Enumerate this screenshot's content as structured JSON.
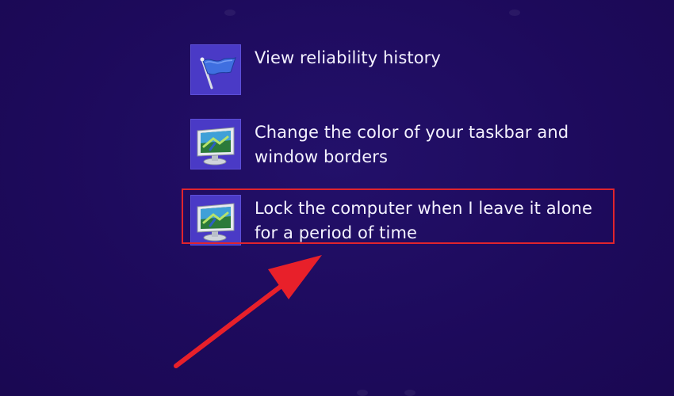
{
  "results": [
    {
      "label": "View reliability history",
      "icon": "flag-icon"
    },
    {
      "label": "Change the color of your taskbar and window borders",
      "icon": "monitor-icon"
    },
    {
      "label": "Lock the computer when I leave it alone for a period of time",
      "icon": "monitor-icon",
      "highlighted": true
    }
  ],
  "colors": {
    "background": "#1e0a5e",
    "tile": "#4a3ac6",
    "highlight": "#e0242d",
    "arrow": "#e8202a",
    "text": "#f4f2ff"
  }
}
